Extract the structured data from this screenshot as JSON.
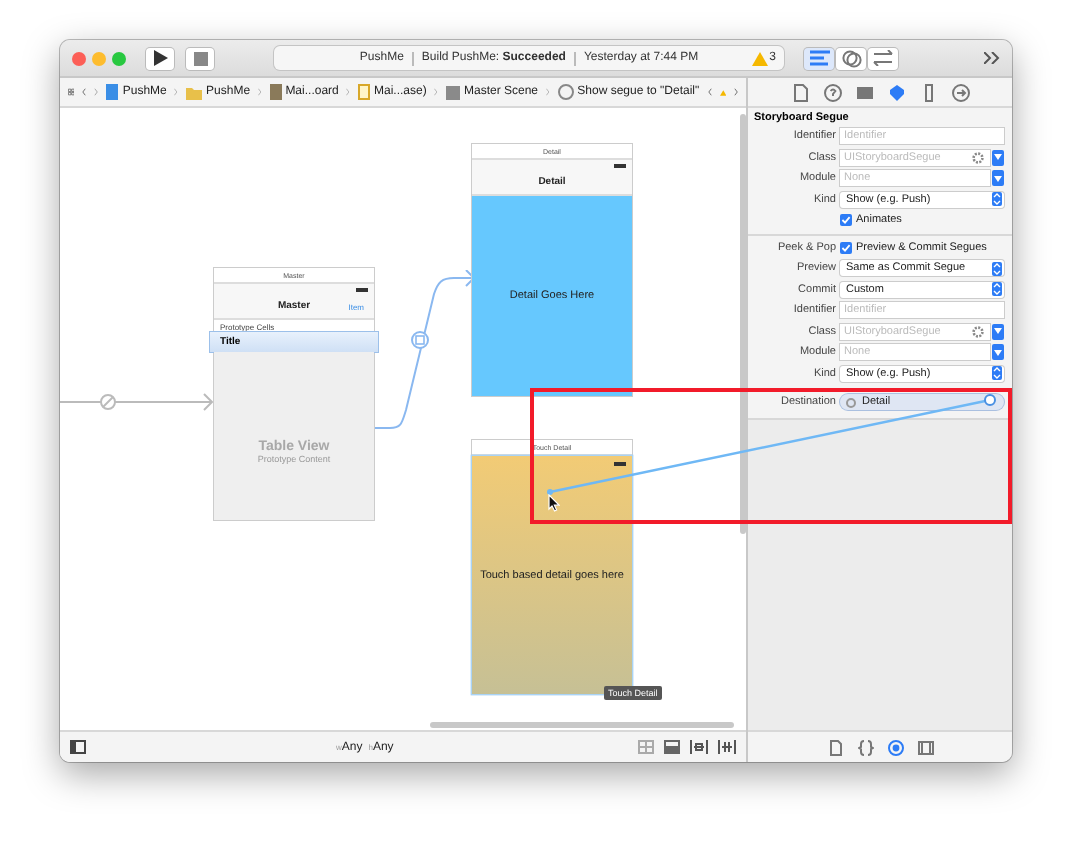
{
  "toolbar": {
    "status": {
      "project": "PushMe",
      "message": "Build PushMe: **Succeeded**",
      "time": "Yesterday at 7:44 PM"
    },
    "warnings": "3"
  },
  "breadcrumbs": [
    {
      "kind": "project",
      "label": "PushMe"
    },
    {
      "kind": "folder",
      "label": "PushMe"
    },
    {
      "kind": "storyboard",
      "label": "Mai...oard"
    },
    {
      "kind": "file",
      "label": "Mai...ase)"
    },
    {
      "kind": "scene",
      "label": "Master Scene"
    },
    {
      "kind": "segue",
      "label": "Show segue to \"Detail\""
    }
  ],
  "inspector_tabs": [
    {
      "selected": false
    },
    {
      "selected": false
    },
    {
      "selected": false
    },
    {
      "selected": true
    },
    {
      "selected": false
    },
    {
      "selected": false
    }
  ],
  "scenes": {
    "master": {
      "title_bar": "Master",
      "nav_title": "Master",
      "nav_item": "Item",
      "section": "Prototype Cells",
      "cell": "Title",
      "placeholder_title": "Table View",
      "placeholder_subtitle": "Prototype Content"
    },
    "detail": {
      "title_bar": "Detail",
      "nav_title": "Detail",
      "body": "Detail Goes Here"
    },
    "touch": {
      "title_bar": "Touch Detail",
      "body": "Touch based detail goes here",
      "badge": "Touch Detail"
    }
  },
  "inspector": {
    "title": "Storyboard Segue",
    "rows": [
      {
        "kind": "text",
        "label": "Identifier",
        "placeholder": "Identifier"
      },
      {
        "kind": "combo",
        "label": "Class",
        "placeholder": "UIStoryboardSegue"
      },
      {
        "kind": "dropdown",
        "label": "Module",
        "placeholder": "None"
      },
      {
        "kind": "popup",
        "label": "Kind",
        "value": "Show (e.g. Push)"
      },
      {
        "kind": "checkbox",
        "text": "Animates",
        "checked": true
      },
      {
        "kind": "divider"
      },
      {
        "kind": "checkbox",
        "label": "Peek & Pop",
        "text": "Preview & Commit Segues",
        "checked": true
      },
      {
        "kind": "popup",
        "label": "Preview",
        "value": "Same as Commit Segue"
      },
      {
        "kind": "popup",
        "label": "Commit",
        "value": "Custom"
      },
      {
        "kind": "text",
        "label": "Identifier",
        "placeholder": "Identifier"
      },
      {
        "kind": "combo",
        "label": "Class",
        "placeholder": "UIStoryboardSegue"
      },
      {
        "kind": "dropdown",
        "label": "Module",
        "placeholder": "None"
      },
      {
        "kind": "popup",
        "label": "Kind",
        "value": "Show (e.g. Push)"
      },
      {
        "kind": "destination",
        "label": "Destination",
        "value": "Detail"
      }
    ]
  },
  "size_class": [
    {
      "prefix": "w",
      "value": "Any"
    },
    {
      "prefix": "h",
      "value": "Any"
    }
  ],
  "library_tabs": [
    {
      "selected": false
    },
    {
      "selected": false
    },
    {
      "selected": true
    },
    {
      "selected": false
    }
  ]
}
